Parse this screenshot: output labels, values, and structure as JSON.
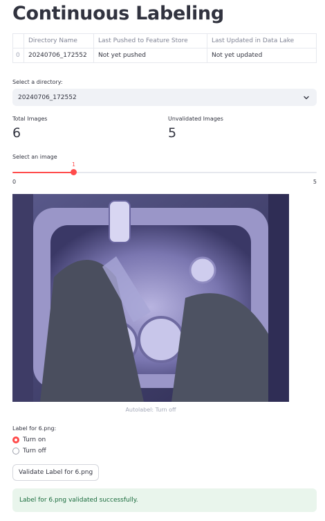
{
  "page": {
    "title": "Continuous Labeling"
  },
  "table": {
    "headers": [
      "",
      "Directory Name",
      "Last Pushed to Feature Store",
      "Last Updated in Data Lake"
    ],
    "rows": [
      [
        "0",
        "20240706_172552",
        "Not yet pushed",
        "Not yet updated"
      ]
    ]
  },
  "directory_select": {
    "label": "Select a directory:",
    "value": "20240706_172552",
    "chevron_icon": "chevron-down-icon"
  },
  "metrics": {
    "total": {
      "label": "Total Images",
      "value": "6"
    },
    "unvalidated": {
      "label": "Unvalidated Images",
      "value": "5"
    }
  },
  "image_slider": {
    "label": "Select an image",
    "value": "1",
    "min": "0",
    "max": "5",
    "fraction": 0.2,
    "accent_color": "#ff4b4b"
  },
  "image": {
    "caption": "Autolabel: Turn off"
  },
  "label_radio": {
    "label": "Label for 6.png:",
    "options": [
      {
        "label": "Turn on",
        "selected": true
      },
      {
        "label": "Turn off",
        "selected": false
      }
    ]
  },
  "validate_button": {
    "label": "Validate Label for 6.png"
  },
  "success_alert": {
    "text": "Label for 6.png validated successfully.",
    "bg_color": "#e9f5ec",
    "text_color": "#186a3b"
  }
}
